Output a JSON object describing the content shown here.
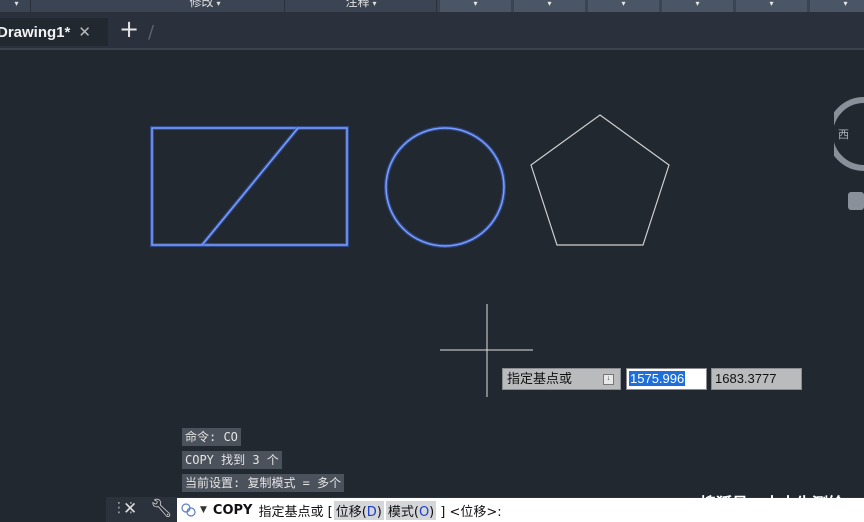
{
  "ribbon": {
    "panels": [
      "修改",
      "注释"
    ],
    "dropdown_count": 6
  },
  "tabs": {
    "drawing_tab": "Drawing1*",
    "close_glyph": "✕",
    "add_glyph": "+"
  },
  "viewcube": {
    "label": "西"
  },
  "dynamic_input": {
    "prompt": "指定基点或",
    "x_value": "1575.996",
    "y_value": "1683.3777"
  },
  "command_history": [
    "命令: CO",
    "COPY 找到 3 个",
    "当前设置:  复制模式 = 多个"
  ],
  "command_line": {
    "command": "COPY",
    "prompt": "指定基点或 [",
    "option1": "位移(",
    "option1_key": "D",
    "option1_end": ")",
    "option2": "模式(",
    "option2_key": "O",
    "option2_end": ")",
    "suffix": "] <位移>:"
  },
  "watermark": "搜狐号@大水牛测绘",
  "colors": {
    "canvas": "#212830",
    "selected_stroke": "#5f8cff",
    "normal_stroke": "#d0d0d0"
  }
}
